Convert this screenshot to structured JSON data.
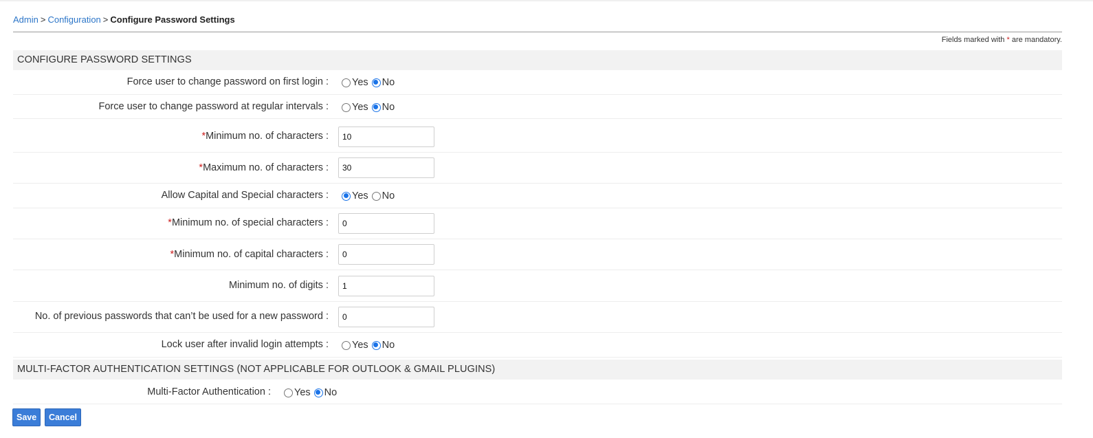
{
  "breadcrumb": {
    "items": [
      "Admin",
      "Configuration"
    ],
    "separator": ">",
    "current": "Configure Password Settings"
  },
  "mandatory_note": {
    "prefix": "Fields marked with",
    "star": "*",
    "suffix": "are mandatory."
  },
  "sections": {
    "password": "CONFIGURE PASSWORD SETTINGS",
    "mfa": "MULTI-FACTOR AUTHENTICATION SETTINGS (NOT APPLICABLE FOR OUTLOOK & GMAIL PLUGINS)"
  },
  "options": {
    "yes": "Yes",
    "no": "No"
  },
  "fields": {
    "first_login": {
      "label": "Force user to change password on first login :",
      "selected": "No"
    },
    "regular_intervals": {
      "label": "Force user to change password at regular intervals :",
      "selected": "No"
    },
    "min_chars": {
      "label": "Minimum no. of characters :",
      "required": true,
      "value": "10"
    },
    "max_chars": {
      "label": "Maximum no. of characters :",
      "required": true,
      "value": "30"
    },
    "capital_special": {
      "label": "Allow Capital and Special characters :",
      "selected": "Yes"
    },
    "min_special": {
      "label": "Minimum no. of special characters :",
      "required": true,
      "value": "0"
    },
    "min_capital": {
      "label": "Minimum no. of capital characters :",
      "required": true,
      "value": "0"
    },
    "min_digits": {
      "label": "Minimum no. of digits :",
      "value": "1"
    },
    "prev_passwords": {
      "label": "No. of previous passwords that can’t be used for a new password :",
      "value": "0"
    },
    "lock_user": {
      "label": "Lock user after invalid login attempts :",
      "selected": "No"
    },
    "mfa": {
      "label": "Multi-Factor Authentication :",
      "selected": "No"
    }
  },
  "buttons": {
    "save": "Save",
    "cancel": "Cancel"
  },
  "colors": {
    "link": "#2d76c8",
    "accent": "#3b7dd8",
    "required": "#cc1f1f",
    "section_bg": "#f2f2f2"
  }
}
